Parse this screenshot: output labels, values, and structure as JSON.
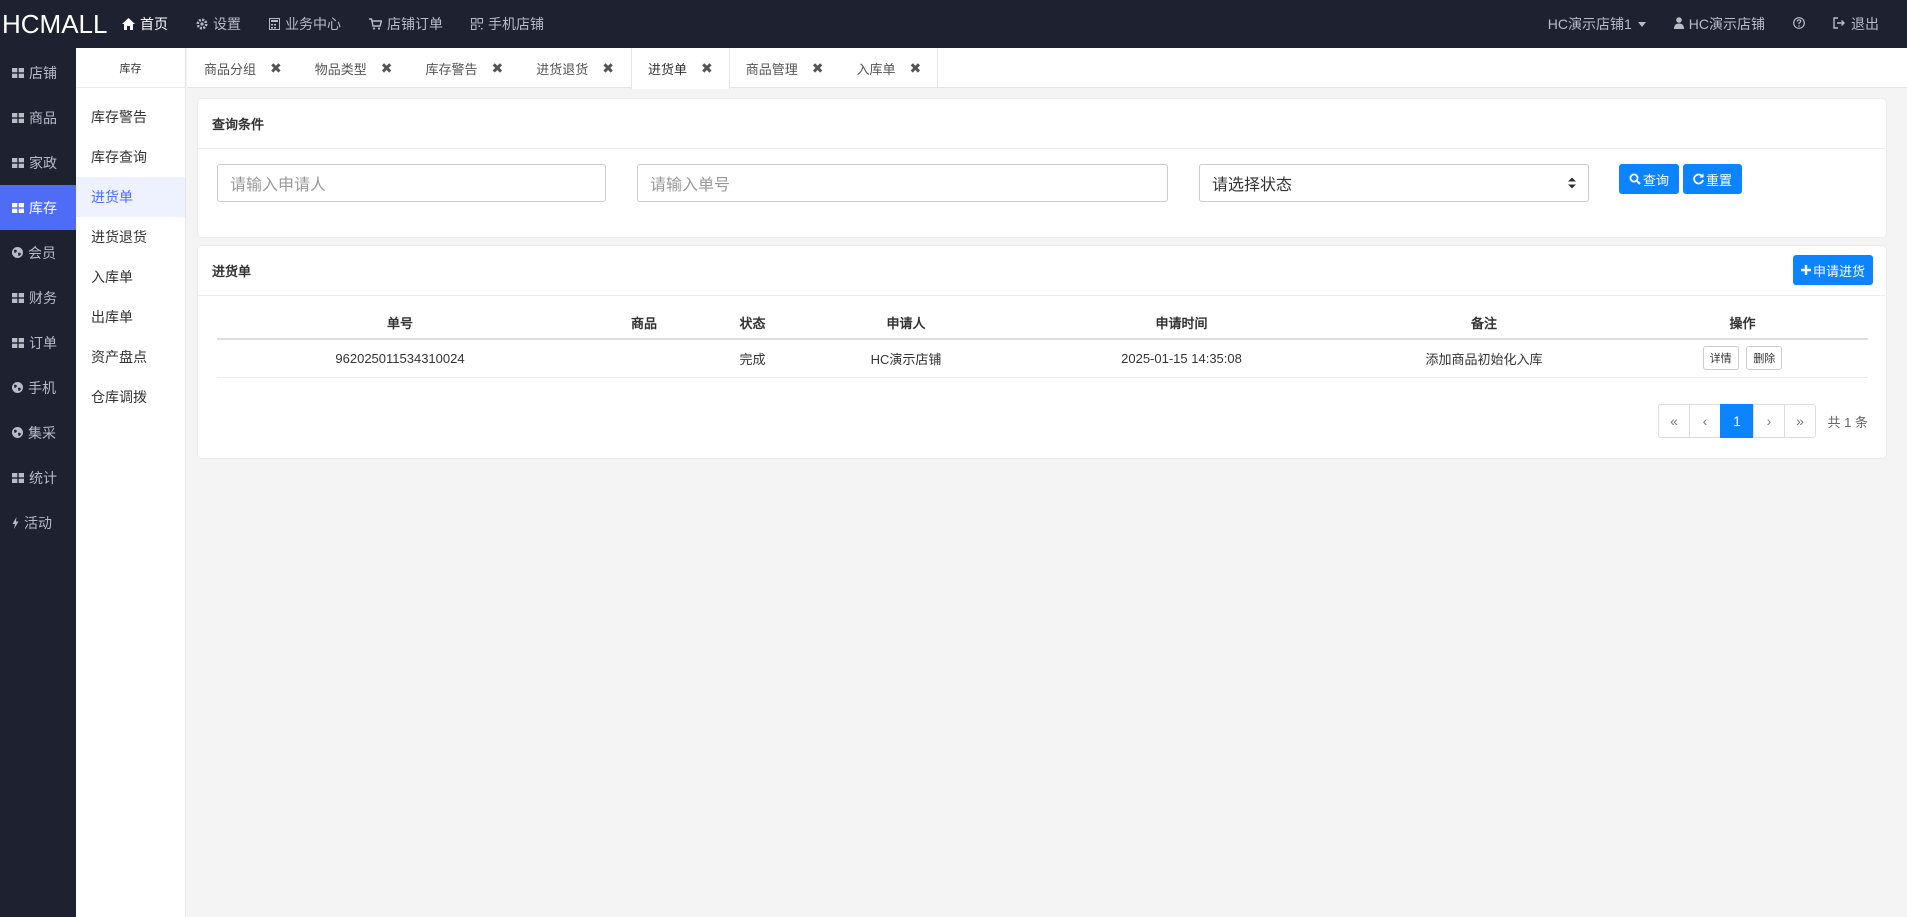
{
  "brand": "HCMALL",
  "topnav": [
    {
      "label": "首页",
      "icon": "home-icon",
      "active": true
    },
    {
      "label": "设置",
      "icon": "gear-icon"
    },
    {
      "label": "业务中心",
      "icon": "calculator-icon"
    },
    {
      "label": "店铺订单",
      "icon": "cart-icon"
    },
    {
      "label": "手机店铺",
      "icon": "qrcode-icon"
    }
  ],
  "topright": {
    "store_select": "HC演示店铺1",
    "user": "HC演示店铺",
    "help_icon": "question-circle-icon",
    "logout": "退出"
  },
  "sidebar": [
    {
      "label": "店铺",
      "icon": "grid-icon"
    },
    {
      "label": "商品",
      "icon": "grid-icon"
    },
    {
      "label": "家政",
      "icon": "grid-icon"
    },
    {
      "label": "库存",
      "icon": "grid-icon",
      "active": true
    },
    {
      "label": "会员",
      "icon": "globe-icon"
    },
    {
      "label": "财务",
      "icon": "grid-icon"
    },
    {
      "label": "订单",
      "icon": "grid-icon"
    },
    {
      "label": "手机",
      "icon": "globe-icon"
    },
    {
      "label": "集采",
      "icon": "globe-icon"
    },
    {
      "label": "统计",
      "icon": "grid-icon"
    },
    {
      "label": "活动",
      "icon": "bolt-icon"
    }
  ],
  "subbar": {
    "title": "库存",
    "items": [
      "库存警告",
      "库存查询",
      "进货单",
      "进货退货",
      "入库单",
      "出库单",
      "资产盘点",
      "仓库调拨"
    ],
    "active_index": 2
  },
  "tabs": [
    {
      "label": "商品分组"
    },
    {
      "label": "物品类型"
    },
    {
      "label": "库存警告"
    },
    {
      "label": "进货退货"
    },
    {
      "label": "进货单",
      "active": true
    },
    {
      "label": "商品管理"
    },
    {
      "label": "入库单"
    }
  ],
  "query": {
    "title": "查询条件",
    "applicant_placeholder": "请输入申请人",
    "order_no_placeholder": "请输入单号",
    "status_select": "请选择状态",
    "search_label": "查询",
    "reset_label": "重置"
  },
  "list": {
    "title": "进货单",
    "add_label": "申请进货",
    "columns": [
      "单号",
      "商品",
      "状态",
      "申请人",
      "申请时间",
      "备注",
      "操作"
    ],
    "rows": [
      {
        "order_no": "962025011534310024",
        "product": "",
        "status": "完成",
        "applicant": "HC演示店铺",
        "time": "2025-01-15 14:35:08",
        "remark": "添加商品初始化入库",
        "detail_label": "详情",
        "delete_label": "删除"
      }
    ],
    "pager": {
      "first": "«",
      "prev": "‹",
      "current": "1",
      "next": "›",
      "last": "»"
    },
    "total": "共 1 条"
  },
  "colors": {
    "accent": "#4f6cf7",
    "primary_button": "#0d84ff",
    "dark_bg": "#1d2130"
  }
}
